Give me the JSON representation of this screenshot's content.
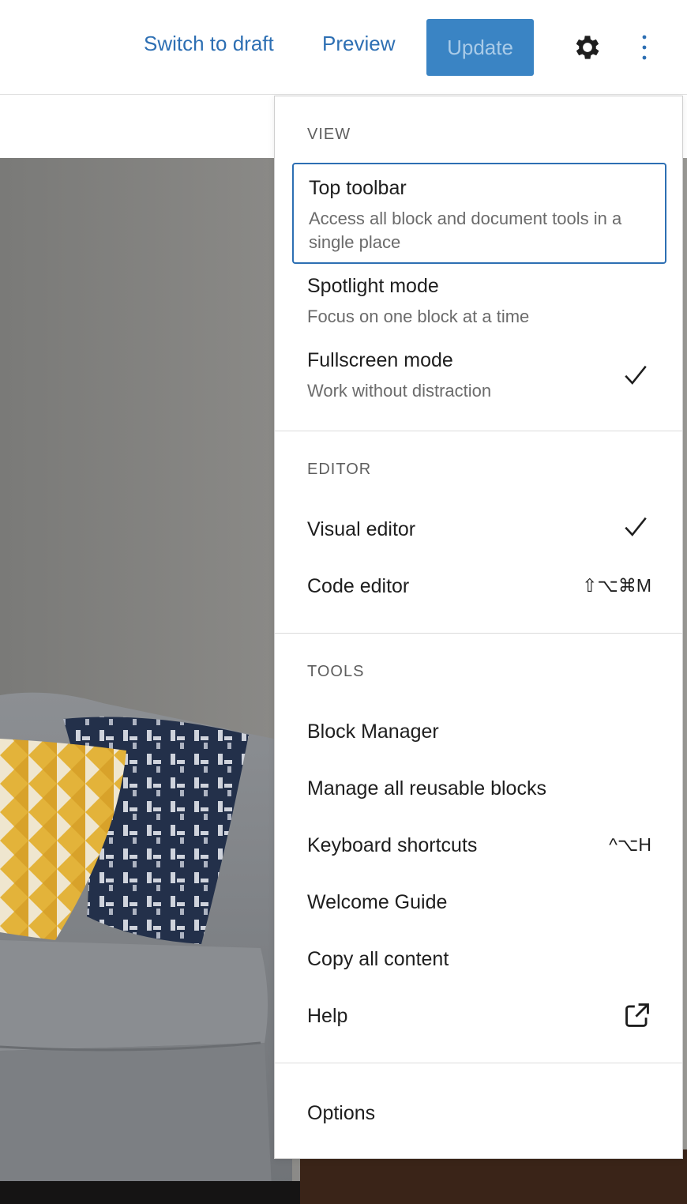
{
  "header": {
    "switch_draft": "Switch to draft",
    "preview": "Preview",
    "update": "Update",
    "settings_icon": "gear-icon",
    "more_icon": "kebab-icon"
  },
  "menu": {
    "view": {
      "title": "VIEW",
      "items": [
        {
          "label": "Top toolbar",
          "desc": "Access all block and document tools in a single place",
          "checked": false
        },
        {
          "label": "Spotlight mode",
          "desc": "Focus on one block at a time",
          "checked": false
        },
        {
          "label": "Fullscreen mode",
          "desc": "Work without distraction",
          "checked": true
        }
      ]
    },
    "editor": {
      "title": "EDITOR",
      "items": [
        {
          "label": "Visual editor",
          "checked": true
        },
        {
          "label": "Code editor",
          "shortcut": "⇧⌥⌘M"
        }
      ]
    },
    "tools": {
      "title": "TOOLS",
      "items": [
        {
          "label": "Block Manager"
        },
        {
          "label": "Manage all reusable blocks"
        },
        {
          "label": "Keyboard shortcuts",
          "shortcut": "^⌥H"
        },
        {
          "label": "Welcome Guide"
        },
        {
          "label": "Copy all content"
        },
        {
          "label": "Help",
          "icon": "external-link-icon"
        }
      ]
    },
    "options": {
      "label": "Options"
    }
  },
  "colors": {
    "accent": "#2d6fb3",
    "update_bg": "#3a84c4"
  }
}
